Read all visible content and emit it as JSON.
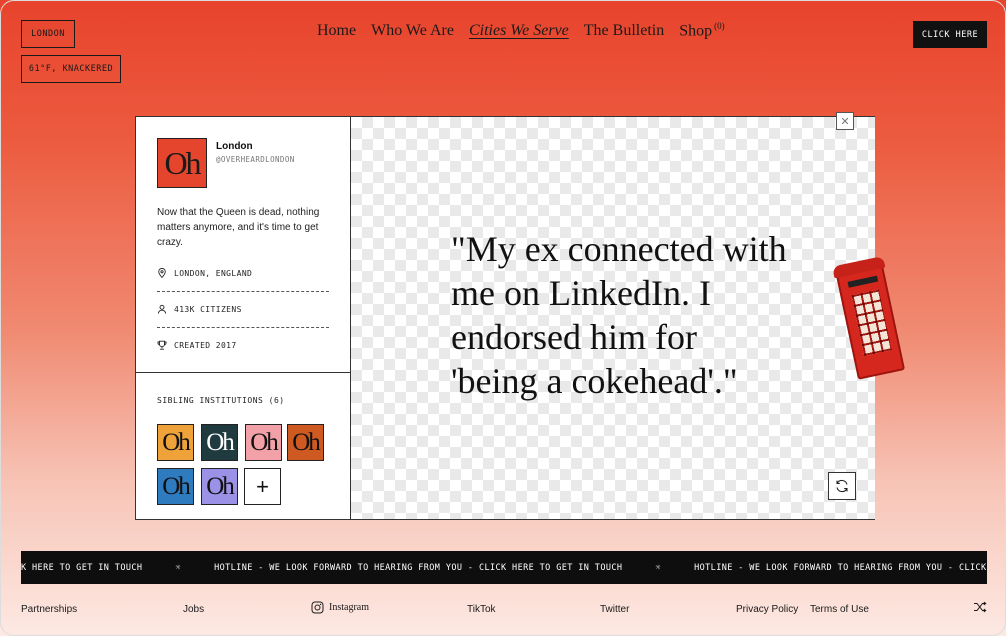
{
  "header": {
    "city_label": "LONDON",
    "weather_label": "61°F, KNACKERED",
    "cta_label": "CLICK HERE"
  },
  "nav": {
    "items": [
      "Home",
      "Who We Are",
      "Cities We Serve",
      "The Bulletin",
      "Shop"
    ],
    "shop_count": "(0)"
  },
  "profile": {
    "logo_text": "Oh",
    "name": "London",
    "handle": "@OVERHEARDLONDON",
    "bio": "Now that the Queen is dead, nothing matters anymore, and it's time to get crazy.",
    "location": "LONDON, ENGLAND",
    "citizens": "413K CITIZENS",
    "created": "CREATED 2017"
  },
  "siblings": {
    "title": "SIBLING INSTITUTIONS (6)",
    "items": [
      {
        "text": "Oh",
        "color": "#f0a23a",
        "fg": "#111111"
      },
      {
        "text": "Oh",
        "color": "#1f3b3f",
        "fg": "#ffffff"
      },
      {
        "text": "Oh",
        "color": "#f3a1a8",
        "fg": "#111111"
      },
      {
        "text": "Oh",
        "color": "#cf5a21",
        "fg": "#111111"
      },
      {
        "text": "Oh",
        "color": "#2f7bc0",
        "fg": "#111111"
      },
      {
        "text": "Oh",
        "color": "#9b91e6",
        "fg": "#111111"
      }
    ],
    "add_label": "+"
  },
  "quote": {
    "text": "\"My ex connected with me on LinkedIn. I endorsed him for 'being a cokehead'.\""
  },
  "ticker": {
    "text": "K HERE TO GET IN TOUCH      ☼      HOTLINE - WE LOOK FORWARD TO HEARING FROM YOU - CLICK HERE TO GET IN TOUCH      ☼      HOTLINE - WE LOOK FORWARD TO HEARING FROM YOU - CLICK HERE TO GET IN TOUCH"
  },
  "footer": {
    "partnerships": "Partnerships",
    "jobs": "Jobs",
    "instagram": "Instagram",
    "tiktok": "TikTok",
    "twitter": "Twitter",
    "privacy": "Privacy Policy",
    "terms": "Terms of Use"
  },
  "icons": {
    "close": "close-icon",
    "refresh": "refresh-icon",
    "location": "location-pin-icon",
    "citizens": "person-icon",
    "created": "trophy-icon",
    "instagram": "instagram-icon",
    "shuffle": "shuffle-icon"
  }
}
